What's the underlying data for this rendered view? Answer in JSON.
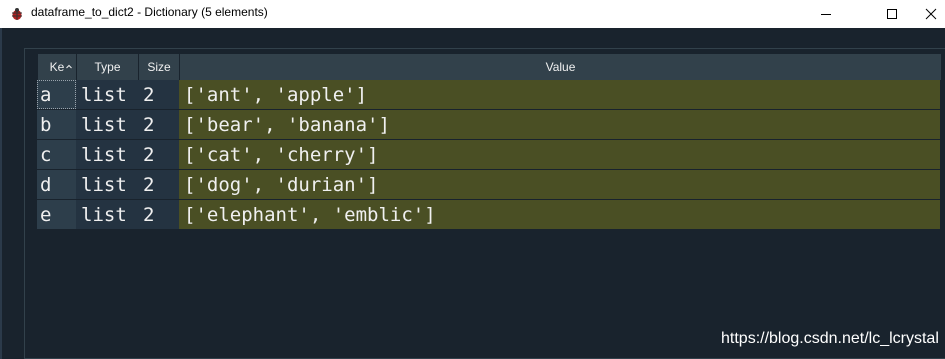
{
  "window": {
    "title": "dataframe_to_dict2 - Dictionary (5 elements)",
    "app_icon": "python-bug-icon",
    "controls": {
      "minimize_icon": "minimize-icon",
      "maximize_icon": "maximize-icon",
      "close_icon": "close-icon"
    }
  },
  "table": {
    "headers": {
      "key": "Ke",
      "type": "Type",
      "size": "Size",
      "value": "Value"
    },
    "sort_indicator": "sort-up-icon",
    "rows": [
      {
        "key": "a",
        "type": "list",
        "size": "2",
        "value": "['ant', 'apple']"
      },
      {
        "key": "b",
        "type": "list",
        "size": "2",
        "value": "['bear', 'banana']"
      },
      {
        "key": "c",
        "type": "list",
        "size": "2",
        "value": "['cat', 'cherry']"
      },
      {
        "key": "d",
        "type": "list",
        "size": "2",
        "value": "['dog', 'durian']"
      },
      {
        "key": "e",
        "type": "list",
        "size": "2",
        "value": "['elephant', 'emblic']"
      }
    ]
  },
  "watermark": "https://blog.csdn.net/lc_lcrystal",
  "colors": {
    "background": "#19232d",
    "header": "#32414b",
    "value_cell": "#4a4f24",
    "text": "#f0f0f0"
  }
}
